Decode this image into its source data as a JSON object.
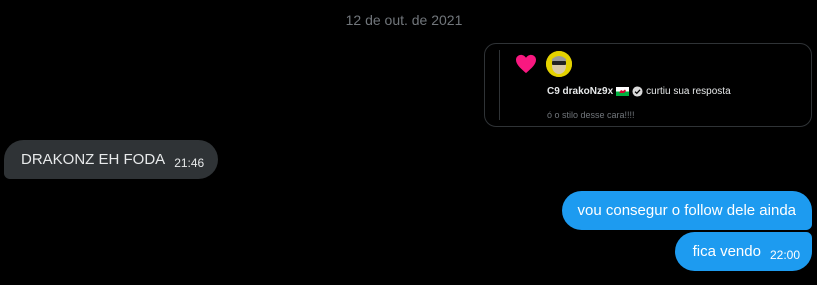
{
  "conversation": {
    "date_separator": "12 de out. de 2021"
  },
  "embedded_card": {
    "user_name": "C9 drakoNz9x",
    "action": "curtiu sua resposta",
    "reply_text": "ó o stilo desse cara!!!!",
    "icons": [
      "heart-icon",
      "avatar",
      "wales-flag-icon",
      "verified-icon"
    ],
    "heart_color": "#f91880"
  },
  "messages": [
    {
      "direction": "incoming",
      "text": "DRAKONZ EH FODA",
      "time": "21:46"
    },
    {
      "direction": "outgoing",
      "text": "vou consegur o follow dele ainda",
      "time": ""
    },
    {
      "direction": "outgoing",
      "text": "fica vendo",
      "time": "22:00"
    }
  ],
  "colors": {
    "background": "#000000",
    "incoming_bubble": "#2f3336",
    "outgoing_bubble": "#1d9bf0",
    "muted_text": "#71767b"
  }
}
